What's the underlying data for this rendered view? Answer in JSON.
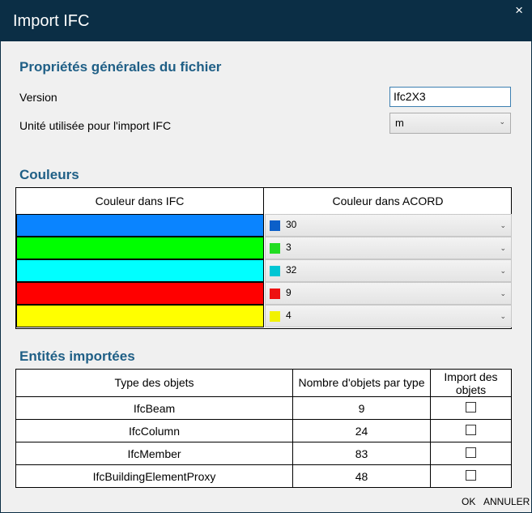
{
  "window": {
    "title": "Import IFC",
    "close_glyph": "×"
  },
  "general": {
    "heading": "Propriétés générales du fichier",
    "version_label": "Version",
    "version_value": "Ifc2X3",
    "unit_label": "Unité utilisée pour l'import IFC",
    "unit_value": "m"
  },
  "colors": {
    "heading": "Couleurs",
    "col_ifc": "Couleur dans IFC",
    "col_acord": "Couleur dans ACORD",
    "rows": [
      {
        "ifc_color": "#0a84ff",
        "acord_color": "#0b5fc9",
        "acord_value": "30"
      },
      {
        "ifc_color": "#00ff00",
        "acord_color": "#22dd22",
        "acord_value": "3"
      },
      {
        "ifc_color": "#00ffff",
        "acord_color": "#00c6d4",
        "acord_value": "32"
      },
      {
        "ifc_color": "#ff0000",
        "acord_color": "#ee1111",
        "acord_value": "9"
      },
      {
        "ifc_color": "#ffff00",
        "acord_color": "#f2f200",
        "acord_value": "4"
      }
    ]
  },
  "entities": {
    "heading": "Entités importées",
    "col_type": "Type des objets",
    "col_count": "Nombre d'objets par type",
    "col_import": "Import des objets",
    "rows": [
      {
        "type": "IfcBeam",
        "count": "9",
        "import": false
      },
      {
        "type": "IfcColumn",
        "count": "24",
        "import": false
      },
      {
        "type": "IfcMember",
        "count": "83",
        "import": false
      },
      {
        "type": "IfcBuildingElementProxy",
        "count": "48",
        "import": false
      }
    ]
  },
  "footer": {
    "ok_label": "OK",
    "cancel_label": "ANNULER"
  },
  "icons": {
    "dropdown": "chevron-down-icon",
    "close": "close-icon"
  }
}
